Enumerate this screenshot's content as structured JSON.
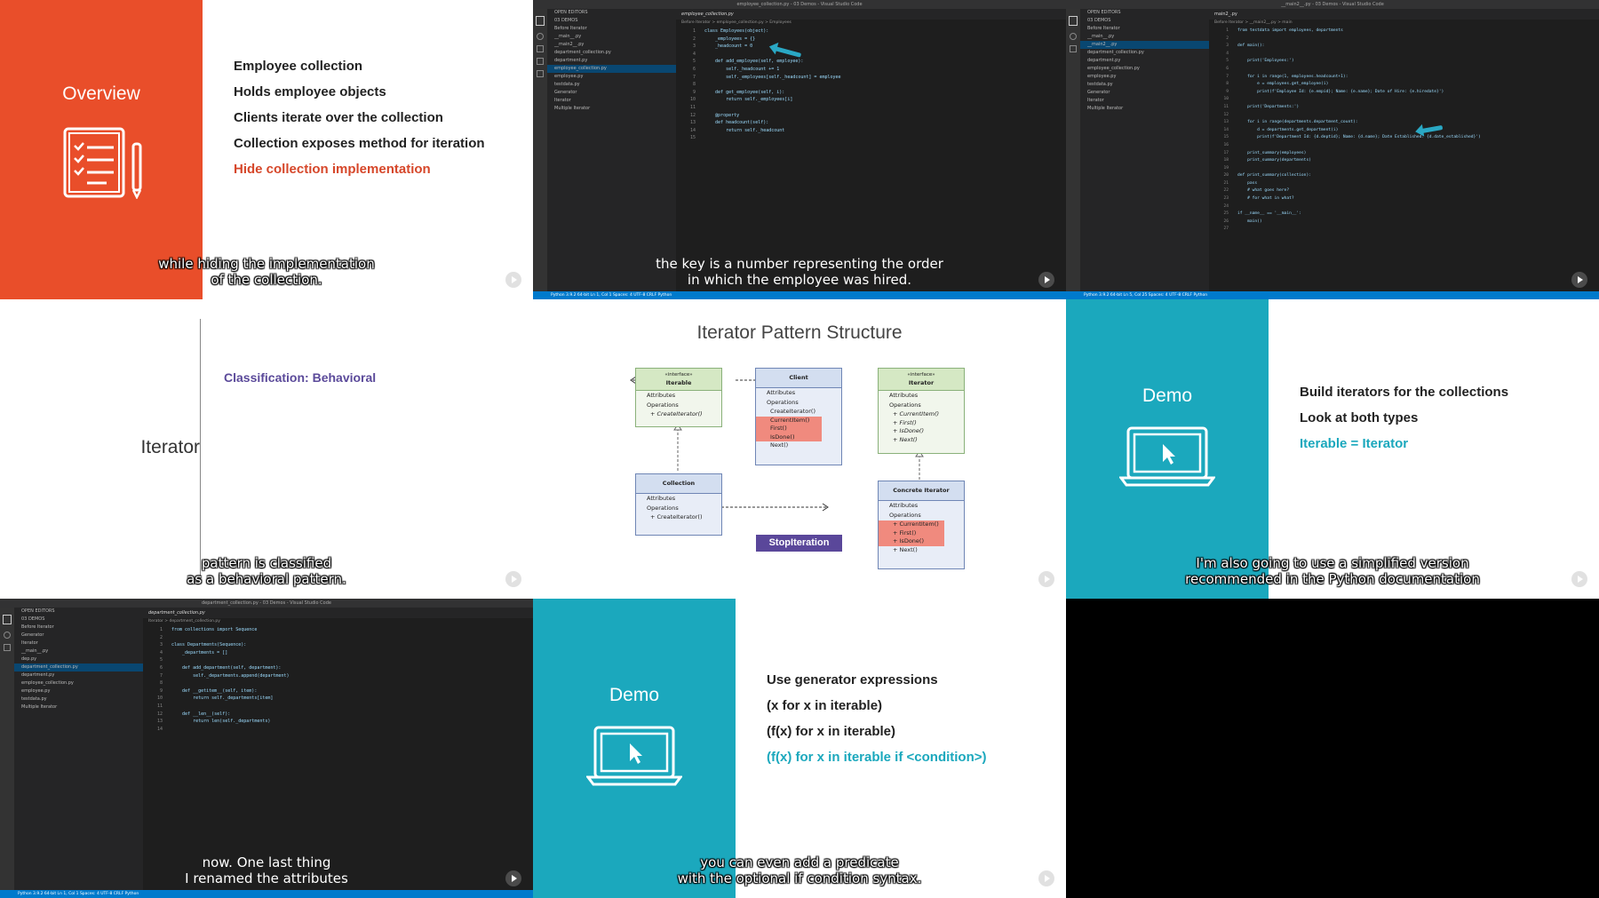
{
  "tiles": {
    "overview": {
      "title": "Overview",
      "bullets": [
        "Employee collection",
        "Holds employee objects",
        "Clients iterate over the collection",
        "Collection exposes method for iteration"
      ],
      "highlight": "Hide collection implementation",
      "subtitle": "while hiding the implementation\nof the collection.",
      "colors": {
        "accent": "#e94e2a",
        "highlight": "#d6472a"
      }
    },
    "vscode1": {
      "title": "employee_collection.py - 03 Demos - Visual Studio Code",
      "tab": "employee_collection.py",
      "breadcrumb": "Before Iterator > employee_collection.py > Employees",
      "sidebar": [
        "OPEN EDITORS",
        "03 DEMOS",
        "Before Iterator",
        "__main__.py",
        "__main2__.py",
        "department_collection.py",
        "department.py",
        "employee_collection.py",
        "employee.py",
        "testdata.py",
        "Generator",
        "Iterator",
        "Multiple Iterator"
      ],
      "sidebar_selected": "employee_collection.py",
      "code": [
        "class Employees(object):",
        "    _employees = {}",
        "    _headcount = 0",
        "",
        "    def add_employee(self, employee):",
        "        self._headcount += 1",
        "        self._employees[self._headcount] = employee",
        "",
        "    def get_employee(self, i):",
        "        return self._employees[i]",
        "",
        "    @property",
        "    def headcount(self):",
        "        return self._headcount",
        ""
      ],
      "subtitle": "the key is a number representing the order\nin which the employee was hired.",
      "status": "Python 3.9.2 64-bit   Ln 1, Col 1   Spaces: 4   UTF-8   CRLF   Python"
    },
    "vscode2": {
      "title": "__main2__.py - 03 Demos - Visual Studio Code",
      "tab": "main2_.py",
      "breadcrumb": "Before Iterator > __main2__.py > main",
      "sidebar": [
        "OPEN EDITORS",
        "03 DEMOS",
        "Before Iterator",
        "__main__.py",
        "__main2__.py",
        "department_collection.py",
        "department.py",
        "employee_collection.py",
        "employee.py",
        "testdata.py",
        "Generator",
        "Iterator",
        "Multiple Iterator"
      ],
      "sidebar_selected": "__main2__.py",
      "code": [
        "from testdata import employees, departments",
        "",
        "def main():",
        "",
        "    print('Employees:')",
        "",
        "    for i in range(1, employees.headcount+1):",
        "        e = employees.get_employee(i)",
        "        print(f'Employee Id: {e.empid}; Name: {e.name}; Date of Hire: {e.hiredate}')",
        "",
        "    print('Departments:')",
        "",
        "    for i in range(departments.department_count):",
        "        d = departments.get_department(i)",
        "        print(f'Department Id: {d.deptid}; Name: {d.name}; Date Established: {d.date_established}')",
        "",
        "    print_summary(employees)",
        "    print_summary(departments)",
        "",
        "def print_summary(collection):",
        "    pass",
        "    # what goes here?",
        "    # for what in what?",
        "",
        "if __name__ == '__main__':",
        "    main()",
        ""
      ],
      "status": "Python 3.9.2 64-bit   Ln 5, Col 25   Spaces: 4   UTF-8   CRLF   Python"
    },
    "iterator": {
      "title": "Iterator",
      "classification": "Classification: Behavioral",
      "subtitle": "pattern is classified\nas a behavioral pattern."
    },
    "structure": {
      "title": "Iterator Pattern Structure",
      "boxes": {
        "iterable": {
          "stereo": "«interface»",
          "name": "Iterable",
          "ops": [
            "+ CreateIterator()"
          ]
        },
        "client": {
          "name": "Client",
          "ops": [
            "CreateIterator()",
            "CurrentItem()",
            "First()",
            "IsDone()",
            "Next()"
          ]
        },
        "iterator": {
          "stereo": "«interface»",
          "name": "Iterator",
          "ops": [
            "+ CurrentItem()",
            "+ First()",
            "+ IsDone()",
            "+ Next()"
          ]
        },
        "collection": {
          "name": "Collection",
          "ops": [
            "+ CreateIterator()"
          ]
        },
        "concrete": {
          "name": "Concrete Iterator",
          "ops": [
            "+ CurrentItem()",
            "+ First()",
            "+ IsDone()",
            "+ Next()"
          ]
        }
      },
      "attributes_label": "Attributes",
      "operations_label": "Operations",
      "stop": "StopIteration"
    },
    "demo1": {
      "title": "Demo",
      "bullets": [
        "Build iterators for the collections",
        "Look at both types"
      ],
      "highlight": "Iterable = Iterator",
      "subtitle": "I'm also going to use a simplified version\nrecommended in the Python documentation",
      "colors": {
        "accent": "#1ba8bd",
        "highlight": "#1ba8bd"
      }
    },
    "vscode3": {
      "title": "department_collection.py - 03 Demos - Visual Studio Code",
      "tab": "department_collection.py",
      "breadcrumb": "Iterator > department_collection.py",
      "sidebar": [
        "OPEN EDITORS",
        "03 DEMOS",
        "Before Iterator",
        "Generator",
        "Iterator",
        "__main__.py",
        "dep.py",
        "department_collection.py",
        "department.py",
        "employee_collection.py",
        "employee.py",
        "testdata.py",
        "Multiple Iterator"
      ],
      "sidebar_selected": "department_collection.py",
      "code": [
        "from collections import Sequence",
        "",
        "class Departments(Sequence):",
        "    _departments = []",
        "",
        "    def add_department(self, department):",
        "        self._departments.append(department)",
        "",
        "    def __getitem__(self, item):",
        "        return self._departments[item]",
        "",
        "    def __len__(self):",
        "        return len(self._departments)",
        ""
      ],
      "subtitle": "now. One last thing\nI renamed the attributes",
      "status": "Python 3.9.2 64-bit   Ln 1, Col 1   Spaces: 4   UTF-8   CRLF   Python"
    },
    "demo2": {
      "title": "Demo",
      "bullets": [
        "Use generator expressions",
        "(x for x in iterable)",
        "(f(x) for x in iterable)"
      ],
      "highlight": "(f(x) for x in iterable if <condition>)",
      "subtitle": "you can even add a predicate\nwith the optional if condition syntax."
    }
  }
}
